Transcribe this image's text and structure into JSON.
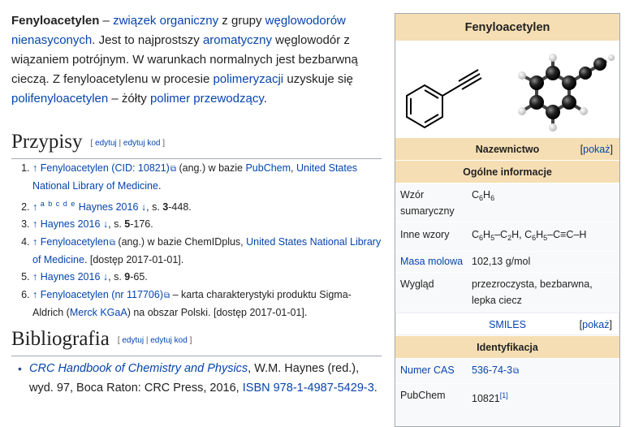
{
  "intro": {
    "bold_title": "Fenyloacetylen",
    "t1": " – ",
    "l_zwiazek": "związek organiczny",
    "t2": " z grupy ",
    "l_weglowodory": "węglowodorów nienasyconych",
    "t3": ". Jest to najprostszy ",
    "l_aromatyczny": "aromatyczny",
    "t4": " węglowodór z wiązaniem potrójnym. W warunkach normalnych jest bezbarwną cieczą. Z fenyloacetylenu w procesie ",
    "l_polimeryzacji": "polimeryzacji",
    "t5": " uzyskuje się ",
    "l_polifenylo": "polifenyloacetylen",
    "t6": " – żółty ",
    "l_polimer": "polimer przewodzący",
    "t7": "."
  },
  "przypisy": {
    "heading": "Przypisy",
    "edit_open": "[ ",
    "edytuj": "edytuj",
    "sep": " | ",
    "edytuj_kod": "edytuj kod",
    "edit_close": " ]",
    "refs": {
      "r1": {
        "arrow": "↑ ",
        "link": "Fenyloacetylen (CID: 10821)",
        "t1": " (ang.) w bazie ",
        "l2": "PubChem",
        "t2": ", ",
        "l3": "United States National Library of Medicine",
        "t3": "."
      },
      "r2": {
        "arrow": "↑ ",
        "sup": "a b c d e",
        "link": "Haynes 2016 ↓",
        "t1": ", s. ",
        "bold": "3",
        "t2": "-448."
      },
      "r3": {
        "arrow": "↑ ",
        "link": "Haynes 2016 ↓",
        "t1": ", s. ",
        "bold": "5",
        "t2": "-176."
      },
      "r4": {
        "arrow": "↑ ",
        "link": "Fenyloacetylen",
        "t1": " (ang.) w bazie ChemIDplus, ",
        "l2": "United States National Library of Medicine",
        "t2": ". [dostęp 2017-01-01]."
      },
      "r5": {
        "arrow": "↑ ",
        "link": "Haynes 2016 ↓",
        "t1": ", s. ",
        "bold": "9",
        "t2": "-65."
      },
      "r6": {
        "arrow": "↑ ",
        "link": "Fenyloacetylen (nr 117706)",
        "t1": " – karta charakterystyki produktu Sigma-Aldrich (",
        "l2": "Merck KGaA",
        "t2": ") na obszar Polski. [dostęp 2017-01-01]."
      }
    }
  },
  "bibliografia": {
    "heading": "Bibliografia",
    "item": {
      "title": "CRC Handbook of Chemistry and Physics",
      "t1": ", W.M. Haynes (red.), wyd. 97, Boca Raton: CRC Press, 2016, ",
      "isbn": "ISBN 978-1-4987-5429-3",
      "t2": "."
    }
  },
  "infobox": {
    "title": "Fenyloacetylen",
    "nazewnictwo": "Nazewnictwo",
    "pokaz": "pokaż",
    "ogolne": "Ogólne informacje",
    "wzor_label": "Wzór sumaryczny",
    "inne_label": "Inne wzory",
    "masa_label": "Masa molowa",
    "masa_value": "102,13 g/mol",
    "wyglad_label": "Wygląd",
    "wyglad_value": "przezroczysta, bezbarwna, lepka ciecz",
    "smiles": "SMILES",
    "identyfikacja": "Identyfikacja",
    "cas_label": "Numer CAS",
    "cas_value": "536-74-3",
    "pubchem_label": "PubChem",
    "pubchem_value": "10821",
    "pubchem_ref": "[1]"
  },
  "colors": {
    "link": "#0645ad",
    "infobox_header": "#f5deb3",
    "border": "#a2a9b1"
  }
}
